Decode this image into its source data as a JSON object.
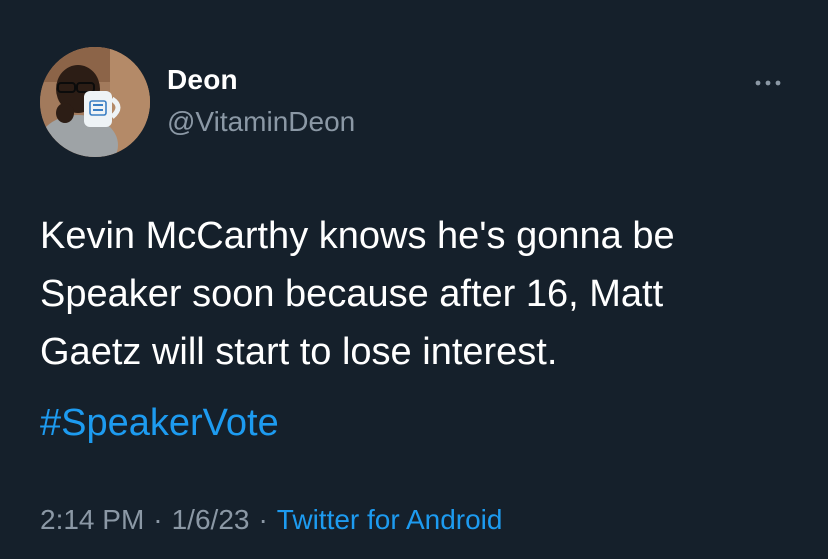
{
  "user": {
    "display_name": "Deon",
    "handle": "@VitaminDeon"
  },
  "more_icon": "more-horizontal-icon",
  "tweet": {
    "text": "Kevin McCarthy knows he's gonna be\nSpeaker soon because after 16, Matt\nGaetz will start to lose interest.",
    "hashtag": "#SpeakerVote"
  },
  "meta": {
    "time": "2:14 PM",
    "date": "1/6/23",
    "separator": "·",
    "source": "Twitter for Android"
  },
  "colors": {
    "background": "#15202b",
    "text": "#ffffff",
    "secondary": "#8b98a5",
    "link": "#1d9bf0"
  }
}
